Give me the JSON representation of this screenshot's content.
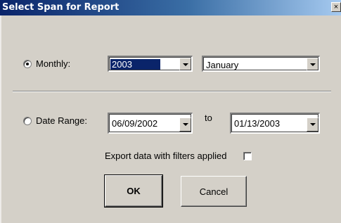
{
  "window": {
    "title": "Select Span for Report",
    "close_glyph": "×"
  },
  "monthly": {
    "label": "Monthly:",
    "checked": true,
    "year_value": "2003",
    "month_value": "January"
  },
  "date_range": {
    "label": "Date Range:",
    "checked": false,
    "start_value": "06/09/2002",
    "to_label": "to",
    "end_value": "01/13/2003"
  },
  "export": {
    "label": "Export data with filters applied",
    "checked": false
  },
  "buttons": {
    "ok_label": "OK",
    "cancel_label": "Cancel"
  },
  "colors": {
    "title_start": "#0a246a",
    "title_end": "#a6caf0",
    "face": "#d4d0c8",
    "selection": "#0a246a"
  }
}
